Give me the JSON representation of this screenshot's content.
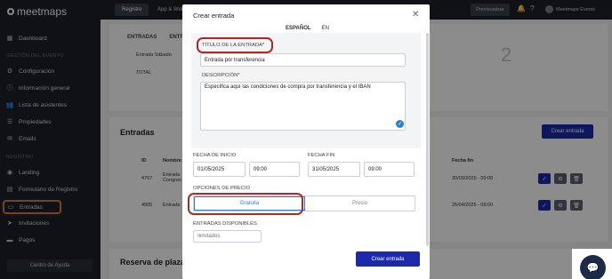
{
  "app": {
    "logo": "meetmaps"
  },
  "topbar": {
    "tabs": [
      "Registro",
      "App & Web"
    ],
    "preview": "Previsualizar",
    "user": "Meetmaps Events"
  },
  "sidebar": {
    "dashboard": "Dashboard",
    "section1": "GESTIÓN DEL EVENTO",
    "items1": [
      "Configuración",
      "Información general",
      "Lista de asistentes",
      "Propiedades",
      "Emails"
    ],
    "section2": "REGISTRO",
    "items2": [
      "Landing",
      "Formulario de Registro",
      "Entradas",
      "Invitaciones",
      "Pagos"
    ],
    "help": "Centro de Ayuda"
  },
  "main": {
    "subtabs": [
      "ENTRADAS",
      "ENTRADAS"
    ],
    "summary_row": "Entrada Sábado",
    "total": "TOTAL",
    "gauge_value": "2",
    "entradas_title": "Entradas",
    "create_entry_btn": "Crear entrada",
    "headers": {
      "id": "ID",
      "nombre": "Nombre",
      "fecha_fin": "Fecha fin"
    },
    "rows": [
      {
        "id": "4767",
        "name": "Entrada Congres",
        "end": "30/09/2025 - 09:00"
      },
      {
        "id": "4905",
        "name": "Entrada",
        "end": "25/04/2025 - 09:00"
      }
    ],
    "reserve_title": "Reserva de plazas"
  },
  "modal": {
    "title": "Crear entrada",
    "lang": [
      "ESPAÑOL",
      "EN"
    ],
    "title_label": "TÍTULO DE LA ENTRADA*",
    "title_value": "Entrada por transferencia",
    "desc_label": "DESCRIPCIÓN*",
    "desc_value": "Especifica aquí las condiciones de compra por transferencia y el IBAN",
    "start_label": "FECHA DE INICIO",
    "start_date": "01/05/2025",
    "start_time": "09:00",
    "end_label": "FECHA FIN",
    "end_date": "31/05/2025",
    "end_time": "09:00",
    "price_label": "OPCIONES DE PRECIO",
    "price_options": [
      "Gratuita",
      "Precio"
    ],
    "avail_label": "ENTRADAS DISPONIBLES",
    "avail_placeholder": "Ilimitados",
    "submit": "Crear entrada"
  },
  "colors": {
    "accent": "#1a2aa8",
    "highlight": "#b02727",
    "sidebar": "#1c1f2a"
  }
}
